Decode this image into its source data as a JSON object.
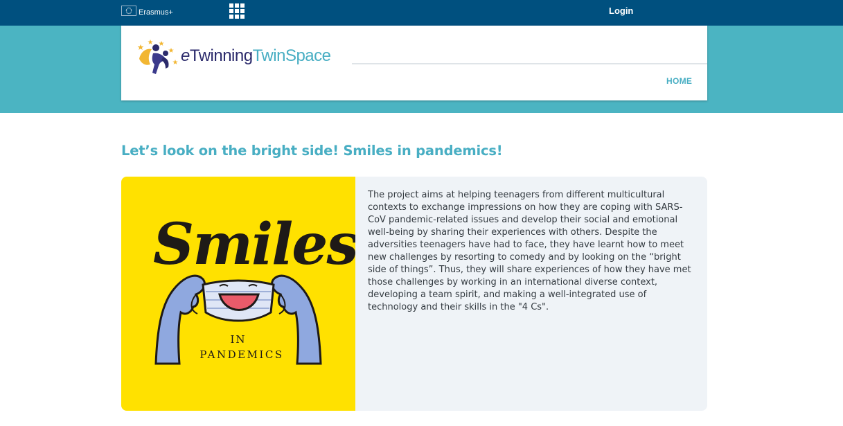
{
  "topbar": {
    "program_label": "Erasmus+",
    "login_label": "Login",
    "icons": [
      "eu-flag-icon",
      "apps-grid-icon"
    ]
  },
  "header": {
    "logo": {
      "e": "e",
      "twinning": "Twinning",
      "twinspace": "TwinSpace"
    },
    "nav": {
      "home_label": "HOME"
    }
  },
  "main": {
    "title": "Let’s look on the bright side! Smiles in pandemics!",
    "cover": {
      "word": "Smiles",
      "line1": "IN",
      "line2": "PANDEMICS"
    },
    "description": "The project aims at helping teenagers from different multicultural contexts to exchange impressions on how they are coping with SARS-CoV pandemic-related issues and develop their social and emotional well-being by sharing their experiences with others. Despite the adversities teenagers have had to face, they have learnt how to meet new challenges by resorting to comedy and by looking on the “bright side of things”. Thus, they will share experiences of how they have met those challenges by working in an international diverse context, developing a team spirit, and making a well-integrated use of technology and their skills in the \"4 Cs\"."
  },
  "colors": {
    "topbar": "#00507f",
    "band": "#4bb4c2",
    "accent": "#48aec3",
    "cover_bg": "#ffe100",
    "card_bg": "#eff3f7",
    "text": "#333a40"
  }
}
